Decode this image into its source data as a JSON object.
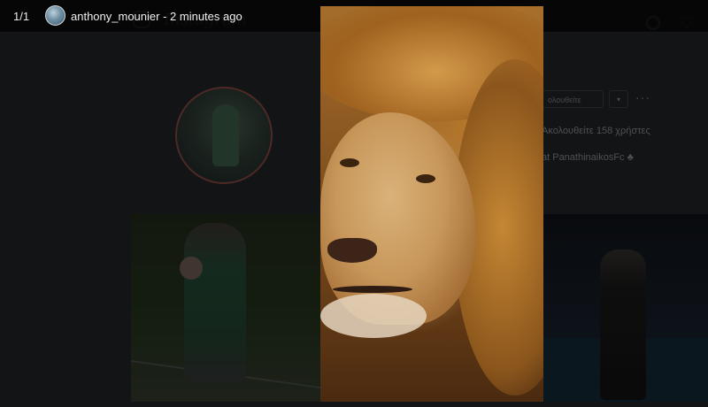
{
  "story": {
    "counter": "1/1",
    "username": "anthony_mounier",
    "separator": " - ",
    "time_ago": "2 minutes ago"
  },
  "background_profile": {
    "follow_button_label": "ολουθείτε",
    "dropdown_icon": "▾",
    "more_icon": "···",
    "following_text": "Ακολουθείτε 158 χρήστες",
    "bio_text": "at PanathinaikosFc ♣",
    "heart_icon": "♡"
  }
}
